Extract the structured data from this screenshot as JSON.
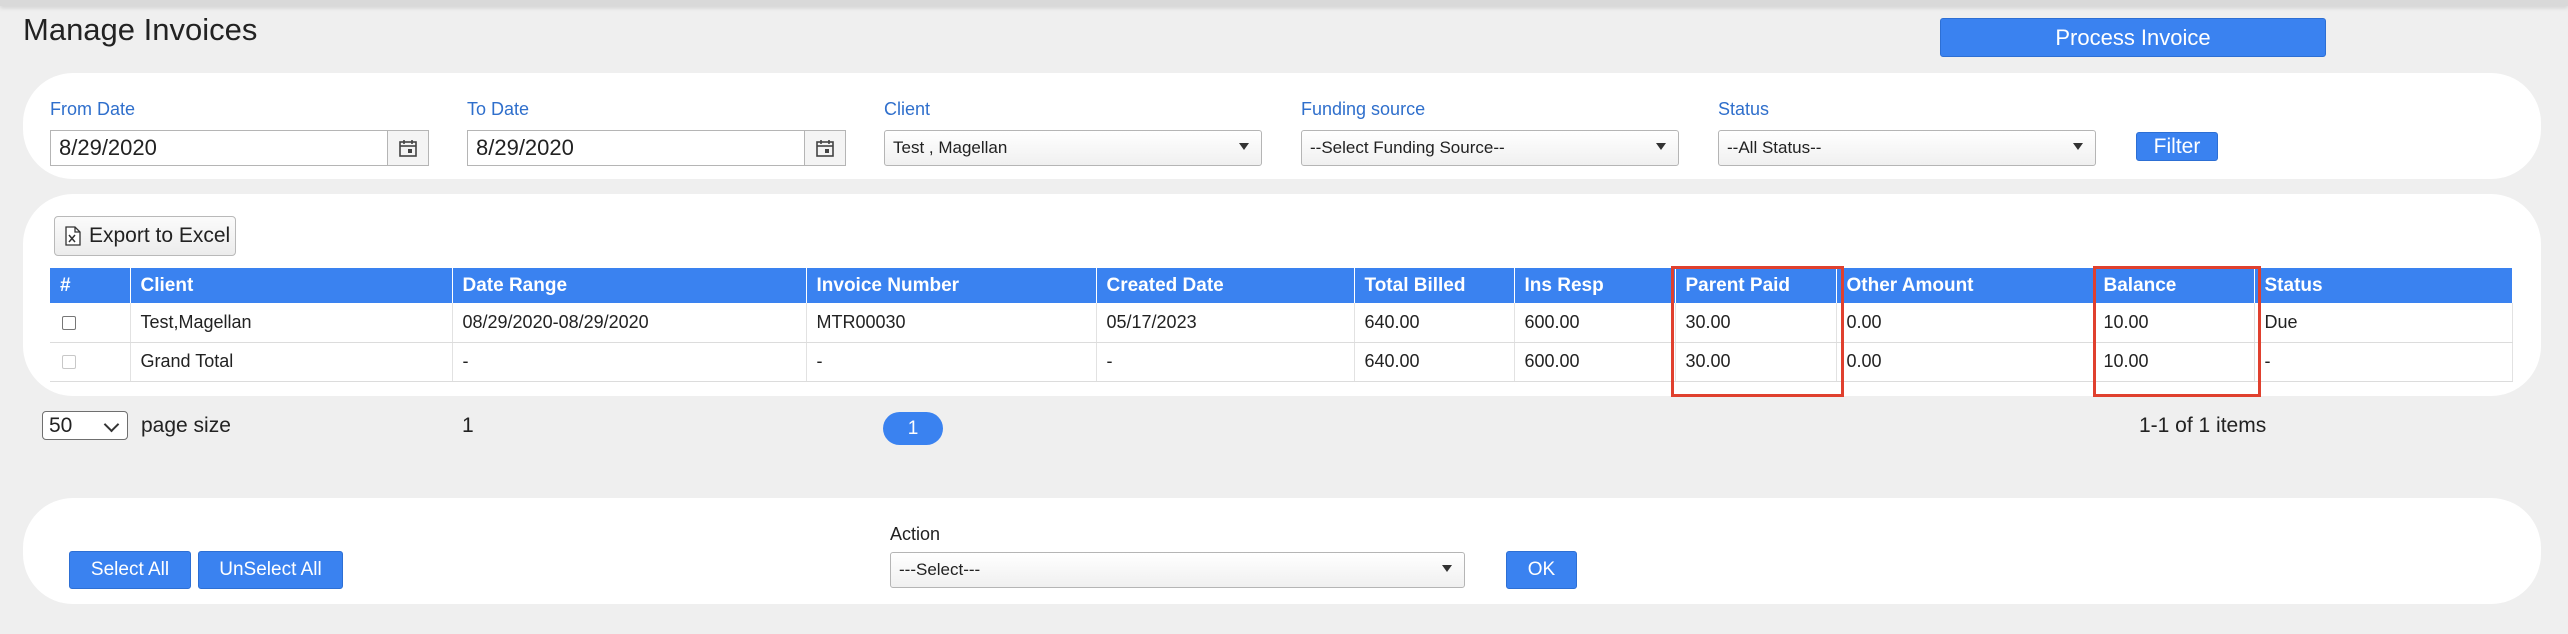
{
  "header": {
    "title": "Manage Invoices",
    "process_label": "Process Invoice"
  },
  "filters": {
    "from_date_label": "From Date",
    "from_date_value": "8/29/2020",
    "to_date_label": "To Date",
    "to_date_value": "8/29/2020",
    "client_label": "Client",
    "client_value": "Test , Magellan",
    "funding_label": "Funding source",
    "funding_value": "--Select Funding Source--",
    "status_label": "Status",
    "status_value": "--All Status--",
    "filter_label": "Filter"
  },
  "grid": {
    "export_label": "Export to Excel",
    "columns": [
      "#",
      "Client",
      "Date Range",
      "Invoice Number",
      "Created Date",
      "Total Billed",
      "Ins Resp",
      "Parent Paid",
      "Other Amount",
      "Balance",
      "Status"
    ],
    "rows": [
      {
        "client": "Test,Magellan",
        "date_range": "08/29/2020-08/29/2020",
        "invoice_number": "MTR00030",
        "created_date": "05/17/2023",
        "total_billed": "640.00",
        "ins_resp": "600.00",
        "parent_paid": "30.00",
        "other_amount": "0.00",
        "balance": "10.00",
        "status": "Due"
      },
      {
        "client": "Grand Total",
        "date_range": "-",
        "invoice_number": "-",
        "created_date": "-",
        "total_billed": "640.00",
        "ins_resp": "600.00",
        "parent_paid": "30.00",
        "other_amount": "0.00",
        "balance": "10.00",
        "status": "-"
      }
    ],
    "highlight_color": "#e0402e"
  },
  "pager": {
    "page_size": "50",
    "page_size_label": "page size",
    "page_number_text": "1",
    "current_page": "1",
    "items_info": "1-1 of 1 items"
  },
  "actions": {
    "select_all_label": "Select All",
    "unselect_all_label": "UnSelect All",
    "action_label": "Action",
    "action_value": "---Select---",
    "ok_label": "OK"
  },
  "colors": {
    "accent": "#3a82f0",
    "label_blue": "#2f6fcc"
  }
}
